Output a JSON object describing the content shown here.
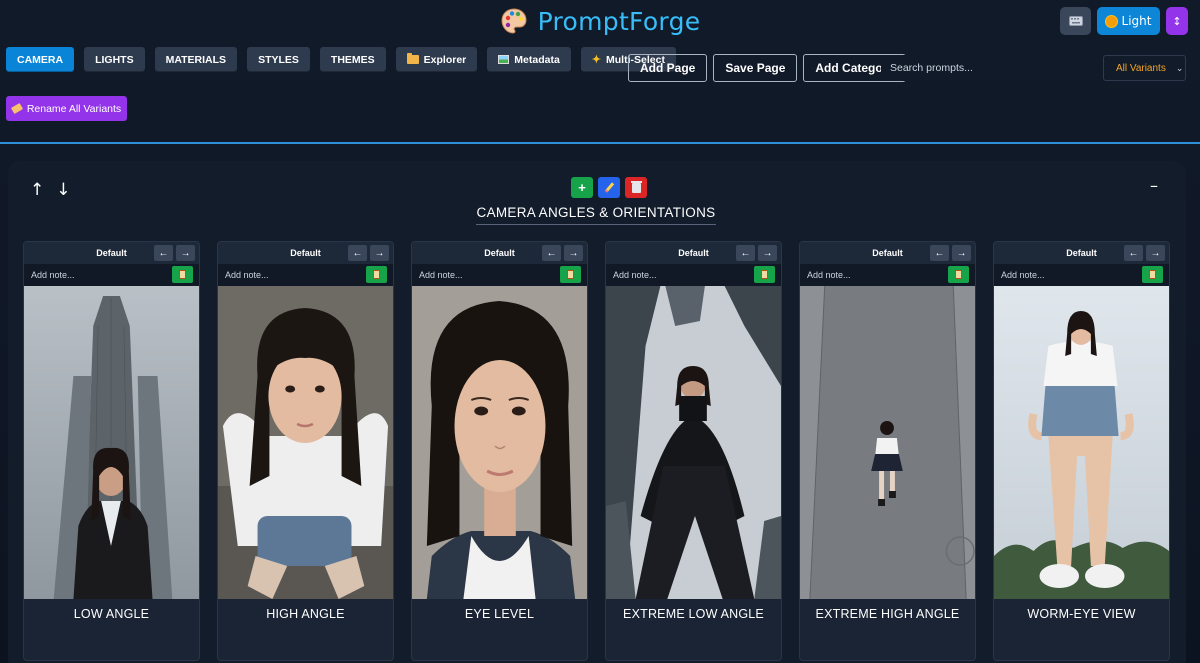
{
  "app": {
    "title": "PromptForge",
    "theme_button": "Light",
    "kbd_icon": "keyboard-icon",
    "sort_icon": "sort-icon"
  },
  "toolbar": {
    "tabs": [
      {
        "label": "CAMERA",
        "active": true
      },
      {
        "label": "LIGHTS",
        "active": false
      },
      {
        "label": "MATERIALS",
        "active": false
      },
      {
        "label": "STYLES",
        "active": false
      },
      {
        "label": "THEMES",
        "active": false
      }
    ],
    "explorer": "Explorer",
    "metadata": "Metadata",
    "multi_select": "Multi-Select",
    "add_page": "Add Page",
    "save_page": "Save Page",
    "add_category": "Add Category",
    "search_placeholder": "Search prompts...",
    "variant_filter": "All Variants",
    "rename_all": "Rename All Variants"
  },
  "category": {
    "title": "CAMERA ANGLES & ORIENTATIONS",
    "up": "↑",
    "down": "↓",
    "add": "+",
    "collapse": "–"
  },
  "cards": [
    {
      "variant": "Default",
      "note_placeholder": "Add note...",
      "label": "LOW ANGLE",
      "image": "low-angle-portrait-in-front-of-skyscraper"
    },
    {
      "variant": "Default",
      "note_placeholder": "Add note...",
      "label": "HIGH ANGLE",
      "image": "high-angle-portrait-looking-up"
    },
    {
      "variant": "Default",
      "note_placeholder": "Add note...",
      "label": "EYE LEVEL",
      "image": "eye-level-headshot"
    },
    {
      "variant": "Default",
      "note_placeholder": "Add note...",
      "label": "EXTREME LOW ANGLE",
      "image": "extreme-low-angle-between-buildings"
    },
    {
      "variant": "Default",
      "note_placeholder": "Add note...",
      "label": "EXTREME HIGH ANGLE",
      "image": "extreme-high-angle-on-pavement"
    },
    {
      "variant": "Default",
      "note_placeholder": "Add note...",
      "label": "WORM-EYE VIEW",
      "image": "worm-eye-view-standing-figure"
    }
  ],
  "colors": {
    "accent": "#0a84d6",
    "title": "#38bdf8",
    "purple": "#9333ea",
    "green": "#16a34a",
    "red": "#dc2626",
    "filter_text": "#f5a524"
  }
}
